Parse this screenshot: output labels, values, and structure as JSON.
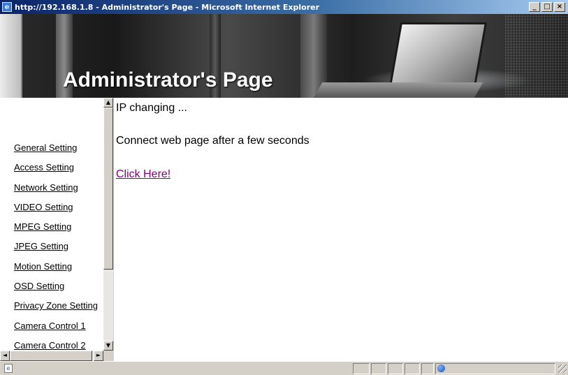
{
  "window": {
    "title": "http://192.168.1.8 - Administrator's Page - Microsoft Internet Explorer",
    "app_icon": "ie-icon",
    "buttons": {
      "minimize": "_",
      "maximize": "□",
      "close": "×"
    }
  },
  "banner": {
    "heading": "Administrator's Page"
  },
  "menu": {
    "items": [
      "General Setting",
      "Access Setting",
      "Network Setting",
      "VIDEO Setting",
      "MPEG Setting",
      "JPEG Setting",
      "Motion Setting",
      "OSD Setting",
      "Privacy Zone Setting",
      "Camera Control 1",
      "Camera Control 2"
    ]
  },
  "scroll": {
    "up": "▲",
    "down": "▼",
    "left": "◄",
    "right": "►"
  },
  "main": {
    "message1": "IP changing ...",
    "message2": "Connect web page after a few seconds",
    "link": "Click Here!"
  },
  "statusbar": {
    "page_icon": "page-icon",
    "zone_icon": "internet-zone-icon"
  }
}
